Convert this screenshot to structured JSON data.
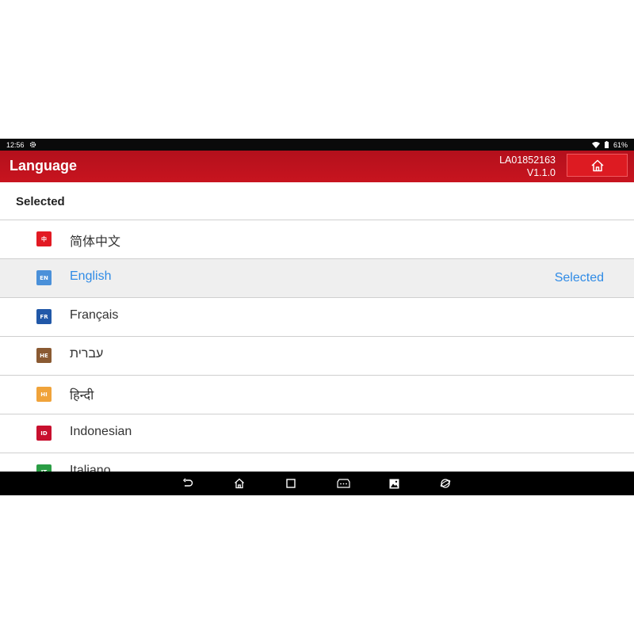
{
  "status_bar": {
    "time": "12:56",
    "battery": "61%",
    "icons": [
      "gear-icon",
      "wifi-icon",
      "battery-icon"
    ]
  },
  "header": {
    "title": "Language",
    "serial": "LA01852163",
    "version": "V1.1.0",
    "home_icon": "home-icon"
  },
  "section": {
    "title": "Selected"
  },
  "languages": [
    {
      "code": "中",
      "name": "简体中文",
      "status": "",
      "color": "#e21a23"
    },
    {
      "code": "EN",
      "name": "English",
      "status": "Selected",
      "color": "#4a90d9"
    },
    {
      "code": "FR",
      "name": "Français",
      "status": "",
      "color": "#2158a8"
    },
    {
      "code": "HE",
      "name": "עברית",
      "status": "",
      "color": "#8a5a32"
    },
    {
      "code": "HI",
      "name": "हिन्दी",
      "status": "",
      "color": "#f0a33a"
    },
    {
      "code": "ID",
      "name": "Indonesian",
      "status": "",
      "color": "#c8102e"
    },
    {
      "code": "IT",
      "name": "Italiano",
      "status": "",
      "color": "#2a9d44"
    }
  ],
  "nav_bar": {
    "icons": [
      "back-icon",
      "home-icon",
      "recents-icon",
      "vci-icon",
      "gallery-icon",
      "browser-icon"
    ]
  }
}
